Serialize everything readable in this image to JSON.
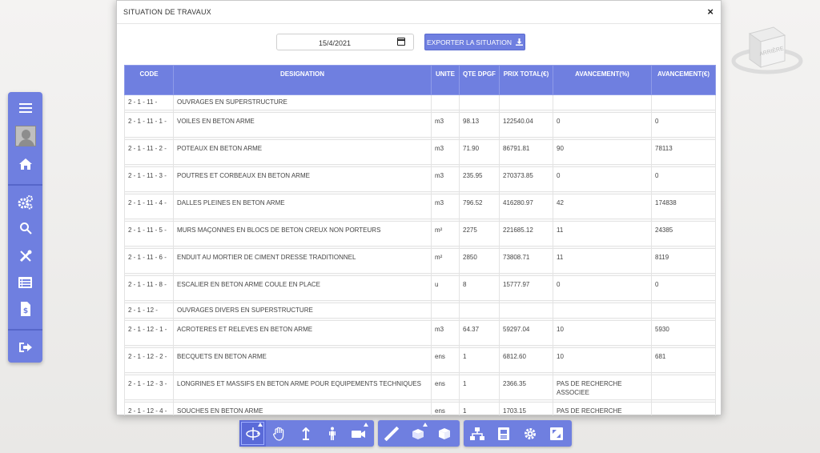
{
  "modal": {
    "title": "SITUATION DE TRAVAUX",
    "close": "×",
    "date_value": "15/4/2021",
    "export_label": "EXPORTER LA SITUATION"
  },
  "cube": {
    "label": "ARRIÈRE"
  },
  "sidebar": {
    "items": [
      {
        "icon": "menu-icon"
      },
      {
        "icon": "avatar"
      },
      {
        "icon": "home-icon"
      },
      {
        "icon": "gears-icon"
      },
      {
        "icon": "search-icon"
      },
      {
        "icon": "tools-icon"
      },
      {
        "icon": "list-icon"
      },
      {
        "icon": "invoice-icon"
      },
      {
        "icon": "logout-icon"
      }
    ]
  },
  "table": {
    "headers": [
      "CODE",
      "DESIGNATION",
      "UNITE",
      "QTE DPGF",
      "PRIX TOTAL(€)",
      "AVANCEMENT(%)",
      "AVANCEMENT(€)"
    ],
    "rows": [
      {
        "type": "grp",
        "code": "2 - 1 - 11 -",
        "designation": "OUVRAGES EN SUPERSTRUCTURE",
        "unite": "",
        "qte": "",
        "prix": "",
        "av_pct": "",
        "av_eur": ""
      },
      {
        "type": "item",
        "code": "2 - 1 - 11 - 1 -",
        "designation": "VOILES EN BETON ARME",
        "unite": "m3",
        "qte": "98.13",
        "prix": "122540.04",
        "av_pct": "0",
        "av_eur": "0"
      },
      {
        "type": "item",
        "code": "2 - 1 - 11 - 2 -",
        "designation": "POTEAUX EN BETON ARME",
        "unite": "m3",
        "qte": "71.90",
        "prix": "86791.81",
        "av_pct": "90",
        "av_eur": "78113"
      },
      {
        "type": "item",
        "code": "2 - 1 - 11 - 3 -",
        "designation": "POUTRES ET CORBEAUX EN BETON ARME",
        "unite": "m3",
        "qte": "235.95",
        "prix": "270373.85",
        "av_pct": "0",
        "av_eur": "0"
      },
      {
        "type": "item",
        "code": "2 - 1 - 11 - 4 -",
        "designation": "DALLES PLEINES EN BETON ARME",
        "unite": "m3",
        "qte": "796.52",
        "prix": "416280.97",
        "av_pct": "42",
        "av_eur": "174838"
      },
      {
        "type": "item",
        "code": "2 - 1 - 11 - 5 -",
        "designation": "MURS MAÇONNES EN BLOCS DE BETON CREUX NON PORTEURS",
        "unite": "m²",
        "qte": "2275",
        "prix": "221685.12",
        "av_pct": "11",
        "av_eur": "24385"
      },
      {
        "type": "item",
        "code": "2 - 1 - 11 - 6 -",
        "designation": "ENDUIT AU MORTIER DE CIMENT DRESSE TRADITIONNEL",
        "unite": "m²",
        "qte": "2850",
        "prix": "73808.71",
        "av_pct": "11",
        "av_eur": "8119"
      },
      {
        "type": "item",
        "code": "2 - 1 - 11 - 8 -",
        "designation": "ESCALIER EN BETON ARME COULE EN PLACE",
        "unite": "u",
        "qte": "8",
        "prix": "15777.97",
        "av_pct": "0",
        "av_eur": "0"
      },
      {
        "type": "grp",
        "code": "2 - 1 - 12 -",
        "designation": "OUVRAGES DIVERS EN SUPERSTRUCTURE",
        "unite": "",
        "qte": "",
        "prix": "",
        "av_pct": "",
        "av_eur": ""
      },
      {
        "type": "item",
        "code": "2 - 1 - 12 - 1 -",
        "designation": "ACROTERES ET RELEVES EN BETON ARME",
        "unite": "m3",
        "qte": "64.37",
        "prix": "59297.04",
        "av_pct": "10",
        "av_eur": "5930"
      },
      {
        "type": "item",
        "code": "2 - 1 - 12 - 2 -",
        "designation": "BECQUETS EN BETON ARME",
        "unite": "ens",
        "qte": "1",
        "prix": "6812.60",
        "av_pct": "10",
        "av_eur": "681"
      },
      {
        "type": "item",
        "code": "2 - 1 - 12 - 3 -",
        "designation": "LONGRINES ET MASSIFS EN BETON ARME POUR EQUIPEMENTS TECHNIQUES",
        "unite": "ens",
        "qte": "1",
        "prix": "2366.35",
        "av_pct": "PAS DE RECHERCHE ASSOCIEE",
        "av_eur": ""
      },
      {
        "type": "item",
        "code": "2 - 1 - 12 - 4 -",
        "designation": "SOUCHES EN BETON ARME",
        "unite": "ens",
        "qte": "1",
        "prix": "1703.15",
        "av_pct": "PAS DE RECHERCHE",
        "av_eur": ""
      }
    ]
  },
  "bottom_toolbar": [
    {
      "group": 1,
      "items": [
        "orbit-icon",
        "pan-hand-icon",
        "vertical-move-icon",
        "walk-person-icon",
        "camera-icon"
      ]
    },
    {
      "group": 2,
      "items": [
        "measure-ruler-icon",
        "section-box-icon",
        "cube-view-icon"
      ]
    },
    {
      "group": 3,
      "items": [
        "model-tree-icon",
        "properties-icon",
        "settings-gear-icon",
        "fullscreen-icon"
      ]
    }
  ]
}
